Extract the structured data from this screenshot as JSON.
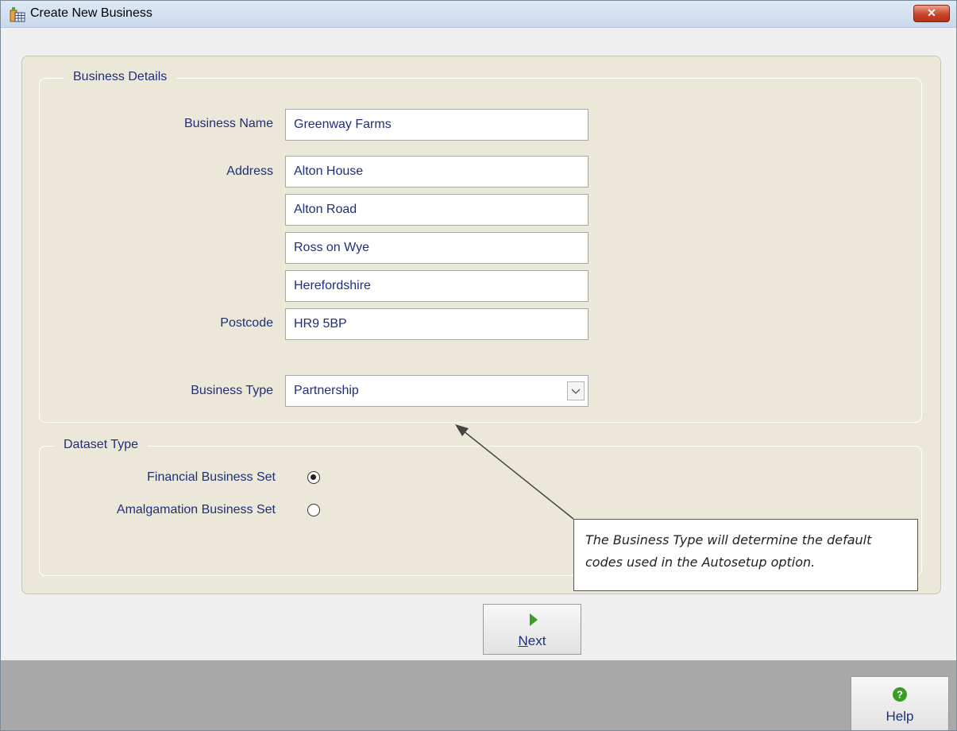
{
  "window": {
    "title": "Create New Business",
    "close_label": "✕",
    "icon": "spreadsheet-icon"
  },
  "business_details": {
    "legend": "Business Details",
    "business_name_label": "Business Name",
    "business_name": "Greenway Farms",
    "address_label": "Address",
    "address": [
      "Alton House",
      "Alton Road",
      "Ross on Wye",
      "Herefordshire"
    ],
    "postcode_label": "Postcode",
    "postcode": "HR9 5BP",
    "business_type_label": "Business Type",
    "business_type": "Partnership"
  },
  "dataset_type": {
    "legend": "Dataset Type",
    "options": [
      {
        "label": "Financial Business Set",
        "selected": true
      },
      {
        "label": "Amalgamation Business Set",
        "selected": false
      }
    ]
  },
  "callout": {
    "text": "The Business Type will determine the default codes used in the Autosetup option."
  },
  "buttons": {
    "next": {
      "underline_letter": "N",
      "rest": "ext",
      "icon": "play-arrow-icon"
    },
    "help": {
      "label": "Help",
      "icon": "question-circle-icon"
    }
  },
  "colors": {
    "label_text": "#1f2f7a",
    "panel_bg": "#ebe7d9",
    "footer_bg": "#a9a9a9",
    "next_arrow": "#3a9e24",
    "help_icon": "#3a9e24"
  }
}
